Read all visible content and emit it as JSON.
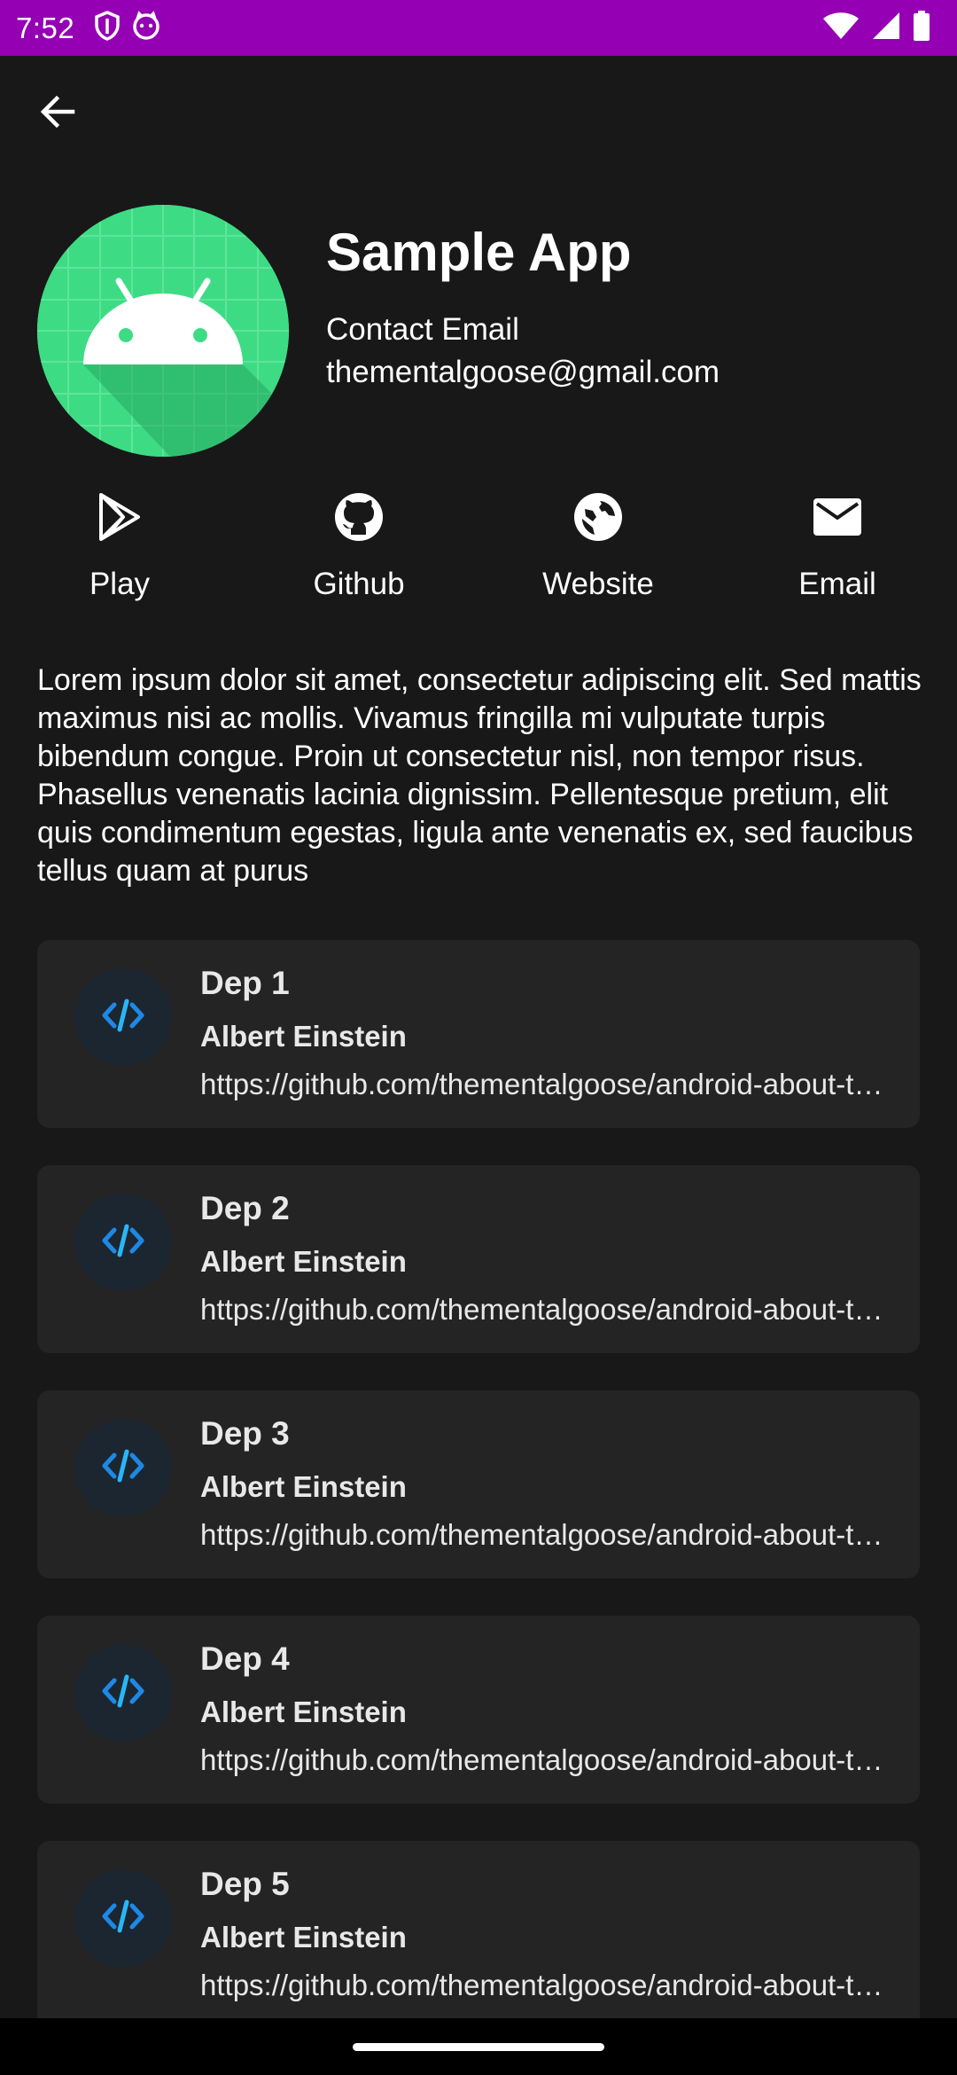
{
  "status_bar": {
    "time": "7:52",
    "left_icons": [
      "shield-icon",
      "cat-notification-icon"
    ],
    "right_icons": [
      "wifi-icon",
      "cellular-icon",
      "battery-icon"
    ],
    "color": "#9500b5"
  },
  "toolbar": {
    "back_icon": "arrow-back-icon"
  },
  "header": {
    "app_icon": "android-logo-icon",
    "app_name": "Sample App",
    "contact_label": "Contact Email",
    "contact_email": "thementalgoose@gmail.com"
  },
  "actions": [
    {
      "icon": "play-store-icon",
      "label": "Play"
    },
    {
      "icon": "github-icon",
      "label": "Github"
    },
    {
      "icon": "globe-icon",
      "label": "Website"
    },
    {
      "icon": "email-icon",
      "label": "Email"
    }
  ],
  "description": "Lorem ipsum dolor sit amet, consectetur adipiscing elit. Sed mattis maximus nisi ac mollis. Vivamus fringilla mi vulputate turpis bibendum congue. Proin ut consectetur nisl, non tempor risus. Phasellus venenatis lacinia dignissim. Pellentesque pretium, elit quis condimentum egestas, ligula ante venenatis ex, sed faucibus tellus quam at purus",
  "dependencies": [
    {
      "name": "Dep 1",
      "author": "Albert Einstein",
      "url": "https://github.com/thementalgoose/android-about-this-app"
    },
    {
      "name": "Dep 2",
      "author": "Albert Einstein",
      "url": "https://github.com/thementalgoose/android-about-this-app"
    },
    {
      "name": "Dep 3",
      "author": "Albert Einstein",
      "url": "https://github.com/thementalgoose/android-about-this-app"
    },
    {
      "name": "Dep 4",
      "author": "Albert Einstein",
      "url": "https://github.com/thementalgoose/android-about-this-app"
    },
    {
      "name": "Dep 5",
      "author": "Albert Einstein",
      "url": "https://github.com/thementalgoose/android-about-this-app"
    }
  ],
  "dependency_icon": "code-icon",
  "colors": {
    "background": "#181818",
    "card": "#242424",
    "code_icon_blue": "#2196f3",
    "android_green": "#3ddc84"
  }
}
